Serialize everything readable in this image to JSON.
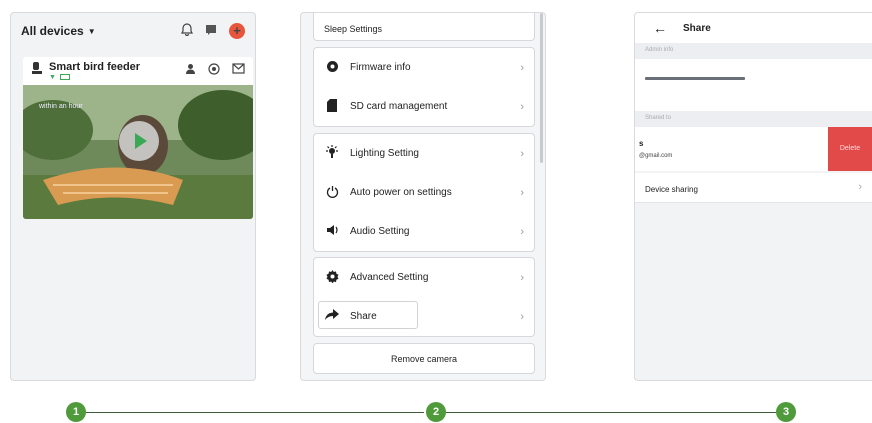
{
  "screen1": {
    "header": {
      "title": "All devices",
      "caret_icon": "caret-down-icon",
      "icons": [
        "bell-icon",
        "message-icon",
        "add-icon"
      ],
      "add_symbol": "+"
    },
    "device": {
      "name": "Smart bird feeder",
      "device_icon": "camera-icon",
      "status_icons": [
        "wifi-icon",
        "battery-icon"
      ],
      "action_icons": [
        "person-icon",
        "settings-icon",
        "mail-icon"
      ],
      "video_overlay_text": "within an hour",
      "play_icon": "play-icon"
    }
  },
  "screen2": {
    "top_item": "Sleep Settings",
    "group1": [
      {
        "label": "Firmware info",
        "icon": "firmware-gear-icon"
      },
      {
        "label": "SD card management",
        "icon": "sd-card-icon"
      }
    ],
    "group2": [
      {
        "label": "Lighting Setting",
        "icon": "light-icon"
      },
      {
        "label": "Auto power on settings",
        "icon": "power-icon"
      },
      {
        "label": "Audio Setting",
        "icon": "speaker-icon"
      }
    ],
    "group3": [
      {
        "label": "Advanced Setting",
        "icon": "gear-icon"
      },
      {
        "label": "Share",
        "icon": "share-arrow-icon"
      }
    ],
    "remove_label": "Remove camera"
  },
  "screen3": {
    "title": "Share",
    "admin_section": "Admin info",
    "shared_section": "Shared to",
    "shared_user_name": "s",
    "shared_user_email": "@gmail.com",
    "delete_label": "Delete",
    "device_sharing_label": "Device sharing"
  },
  "steps": [
    "1",
    "2",
    "3"
  ],
  "colors": {
    "accent_green": "#4f9a3a",
    "delete_red": "#e24a4a",
    "add_orange": "#e8553d",
    "wifi_green": "#3aa856"
  }
}
